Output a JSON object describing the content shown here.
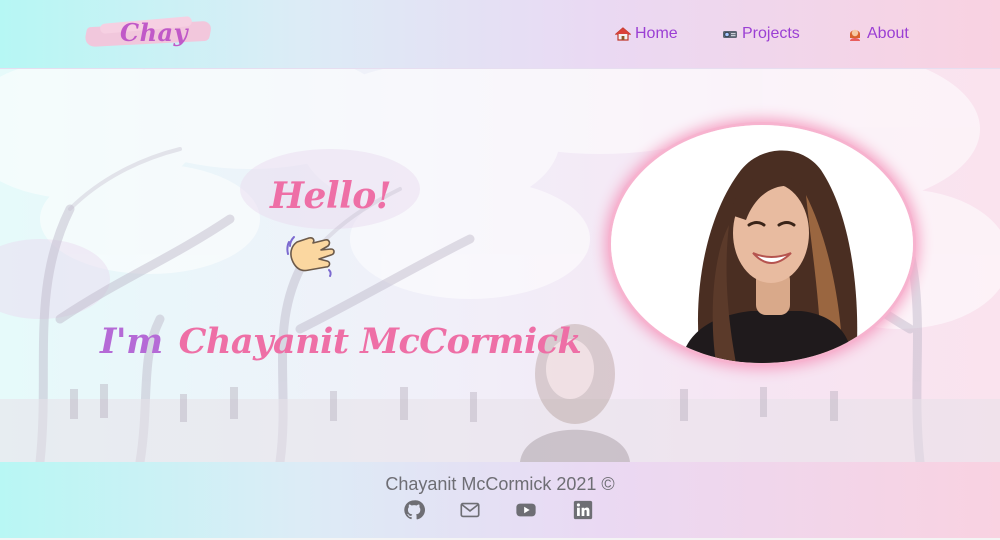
{
  "header": {
    "logo_text": "Chay",
    "nav": [
      {
        "label": "Home",
        "icon": "house-icon"
      },
      {
        "label": "Projects",
        "icon": "projector-icon"
      },
      {
        "label": "About",
        "icon": "person-icon"
      }
    ]
  },
  "hero": {
    "greeting": "Hello!",
    "greeting_icon": "waving-hand-icon",
    "intro_prefix": "I'm",
    "name": "Chayanit  McCormick",
    "photo_alt": "profile-photo"
  },
  "footer": {
    "copyright": "Chayanit McCormick 2021 ©",
    "social_icons": [
      "github-icon",
      "mail-icon",
      "youtube-icon",
      "linkedin-icon"
    ]
  },
  "colors": {
    "accent_purple": "#9b3fd4",
    "accent_pink": "#ee6fa6",
    "lavender": "#b56ad6",
    "footer_text": "#6e6e74"
  }
}
